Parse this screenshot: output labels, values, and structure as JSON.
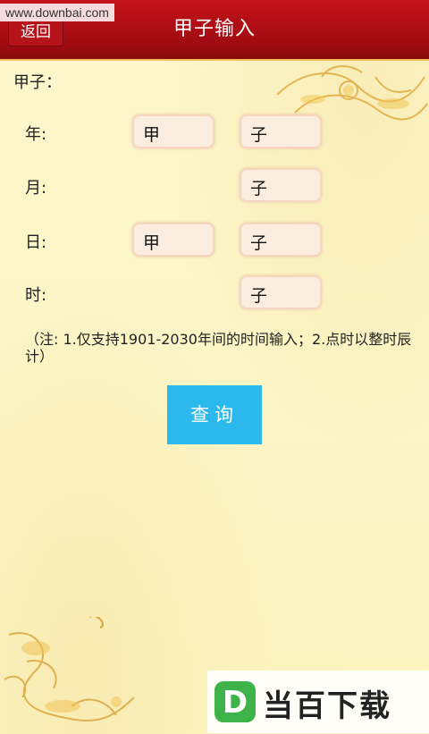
{
  "watermark": "www.downbai.com",
  "header": {
    "back_label": "返回",
    "title": "甲子输入"
  },
  "section_label": "甲子：",
  "rows": [
    {
      "label": "年:",
      "stem": "甲",
      "branch": "子"
    },
    {
      "label": "月:",
      "stem": "",
      "branch": "子"
    },
    {
      "label": "日:",
      "stem": "甲",
      "branch": "子"
    },
    {
      "label": "时:",
      "stem": "",
      "branch": "子"
    }
  ],
  "note": "（注: 1.仅支持1901-2030年间的时间输入；2.点时以整时辰计）",
  "query_label": "查询",
  "logo": {
    "mark": "D",
    "text": "当百下载"
  },
  "colors": {
    "header": "#b5121a",
    "query_button": "#2bb8ec",
    "background": "#fdf6c6",
    "logo_green": "#3db34a"
  }
}
